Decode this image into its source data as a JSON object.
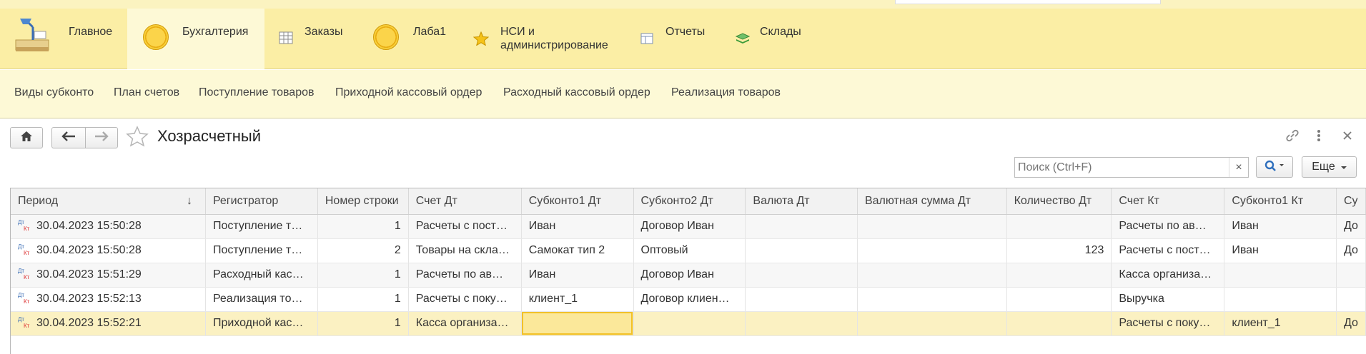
{
  "sections": [
    {
      "label": "Главное",
      "icon": "desk-lamp-icon"
    },
    {
      "label": "Бухгалтерия",
      "icon": "coin-icon",
      "active": true
    },
    {
      "label": "Заказы",
      "icon": "table-grid-icon"
    },
    {
      "label": "Лаба1",
      "icon": "coin-icon"
    },
    {
      "label_line1": "НСИ и",
      "label_line2": "администрирование",
      "icon": "star-icon"
    },
    {
      "label": "Отчеты",
      "icon": "report-icon"
    },
    {
      "label": "Склады",
      "icon": "warehouse-icon"
    }
  ],
  "nav_links": [
    "Виды субконто",
    "План счетов",
    "Поступление товаров",
    "Приходной кассовый ордер",
    "Расходный кассовый ордер",
    "Реализация товаров"
  ],
  "form": {
    "title": "Хозрасчетный",
    "search_placeholder": "Поиск (Ctrl+F)",
    "more_label": "Еще",
    "clear_symbol": "×"
  },
  "table": {
    "columns": [
      "Период",
      "Регистратор",
      "Номер строки",
      "Счет Дт",
      "Субконто1 Дт",
      "Субконто2 Дт",
      "Валюта Дт",
      "Валютная сумма Дт",
      "Количество Дт",
      "Счет Кт",
      "Субконто1 Кт",
      "Су"
    ],
    "sort_indicator": "↓",
    "rows": [
      {
        "period": "30.04.2023 15:50:28",
        "registrar": "Поступление т…",
        "line": "1",
        "acct_dt": "Расчеты с пост…",
        "sub1_dt": "Иван",
        "sub2_dt": "Договор Иван",
        "cur_dt": "",
        "cur_sum_dt": "",
        "qty_dt": "",
        "acct_kt": "Расчеты по ав…",
        "sub1_kt": "Иван",
        "sub2_kt": "До"
      },
      {
        "period": "30.04.2023 15:50:28",
        "registrar": "Поступление т…",
        "line": "2",
        "acct_dt": "Товары на скла…",
        "sub1_dt": "Самокат тип 2",
        "sub2_dt": "Оптовый",
        "cur_dt": "",
        "cur_sum_dt": "",
        "qty_dt": "123",
        "acct_kt": "Расчеты с пост…",
        "sub1_kt": "Иван",
        "sub2_kt": "До"
      },
      {
        "period": "30.04.2023 15:51:29",
        "registrar": "Расходный кас…",
        "line": "1",
        "acct_dt": "Расчеты по ав…",
        "sub1_dt": "Иван",
        "sub2_dt": "Договор Иван",
        "cur_dt": "",
        "cur_sum_dt": "",
        "qty_dt": "",
        "acct_kt": "Касса организа…",
        "sub1_kt": "",
        "sub2_kt": ""
      },
      {
        "period": "30.04.2023 15:52:13",
        "registrar": "Реализация то…",
        "line": "1",
        "acct_dt": "Расчеты с поку…",
        "sub1_dt": "клиент_1",
        "sub2_dt": "Договор клиен…",
        "cur_dt": "",
        "cur_sum_dt": "",
        "qty_dt": "",
        "acct_kt": "Выручка",
        "sub1_kt": "",
        "sub2_kt": ""
      },
      {
        "period": "30.04.2023 15:52:21",
        "registrar": "Приходной кас…",
        "line": "1",
        "acct_dt": "Касса организа…",
        "sub1_dt": "",
        "sub2_dt": "",
        "cur_dt": "",
        "cur_sum_dt": "",
        "qty_dt": "",
        "acct_kt": "Расчеты с поку…",
        "sub1_kt": "клиент_1",
        "sub2_kt": "До"
      }
    ]
  },
  "row_icon": {
    "dt": "Дт",
    "kt": "Кт"
  },
  "colors": {
    "panel": "#fbeea5",
    "active_section": "#fdf9d6",
    "selected_row": "#fbf1c2",
    "focus_cell": "#f2c129"
  }
}
